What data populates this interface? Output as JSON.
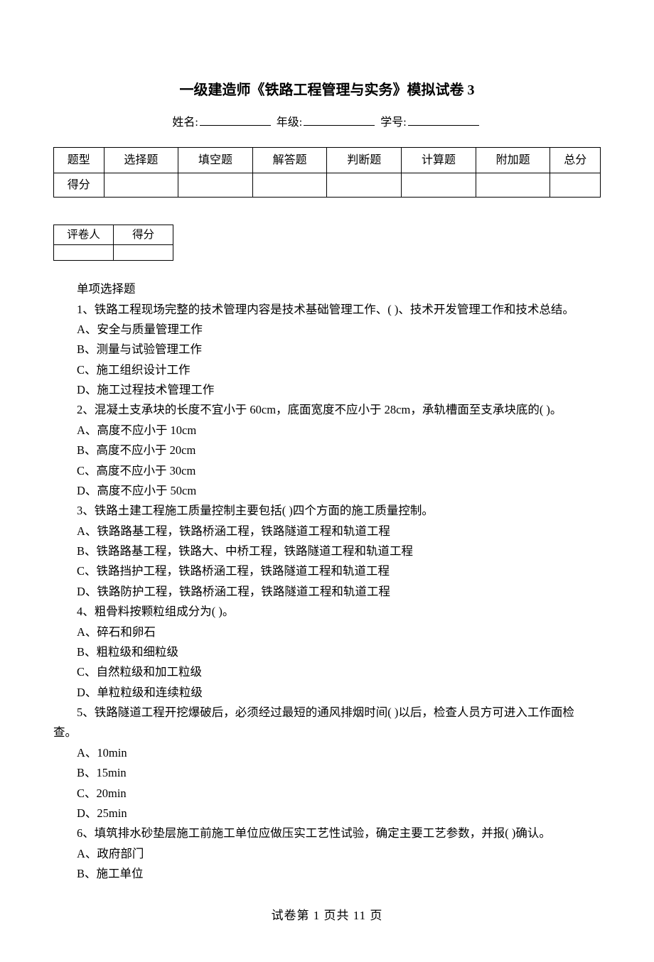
{
  "title": "一级建造师《铁路工程管理与实务》模拟试卷 3",
  "meta": {
    "name_label": "姓名:",
    "grade_label": "年级:",
    "id_label": "学号:"
  },
  "score_table": {
    "headers": [
      "题型",
      "选择题",
      "填空题",
      "解答题",
      "判断题",
      "计算题",
      "附加题",
      "总分"
    ],
    "row_label": "得分"
  },
  "grader_table": {
    "grader": "评卷人",
    "score": "得分"
  },
  "section_heading": "单项选择题",
  "questions": [
    {
      "stem": "1、铁路工程现场完整的技术管理内容是技术基础管理工作、(    )、技术开发管理工作和技术总结。",
      "options": [
        "A、安全与质量管理工作",
        "B、测量与试验管理工作",
        "C、施工组织设计工作",
        "D、施工过程技术管理工作"
      ]
    },
    {
      "stem": "2、混凝土支承块的长度不宜小于 60cm，底面宽度不应小于 28cm，承轨槽面至支承块底的(    )。",
      "options": [
        "A、高度不应小于 10cm",
        "B、高度不应小于 20cm",
        "C、高度不应小于 30cm",
        "D、高度不应小于 50cm"
      ]
    },
    {
      "stem": "3、铁路土建工程施工质量控制主要包括(    )四个方面的施工质量控制。",
      "options": [
        "A、铁路路基工程，铁路桥涵工程，铁路隧道工程和轨道工程",
        "B、铁路路基工程，铁路大、中桥工程，铁路隧道工程和轨道工程",
        "C、铁路挡护工程，铁路桥涵工程，铁路隧道工程和轨道工程",
        "D、铁路防护工程，铁路桥涵工程，铁路隧道工程和轨道工程"
      ]
    },
    {
      "stem": "4、粗骨料按颗粒组成分为(    )。",
      "options": [
        "A、碎石和卵石",
        "B、粗粒级和细粒级",
        "C、自然粒级和加工粒级",
        "D、单粒粒级和连续粒级"
      ]
    },
    {
      "stem_pre": "5、铁路隧道工程开挖爆破后，必须经过最短的通风排烟时间(    )以后，检查人员方可进入工作面检",
      "stem_wrap": "查。",
      "options": [
        "A、10min",
        "B、15min",
        "C、20min",
        "D、25min"
      ]
    },
    {
      "stem": "6、填筑排水砂垫层施工前施工单位应做压实工艺性试验，确定主要工艺参数，并报(    )确认。",
      "options": [
        "A、政府部门",
        "B、施工单位"
      ]
    }
  ],
  "footer": "试卷第 1 页共 11 页"
}
